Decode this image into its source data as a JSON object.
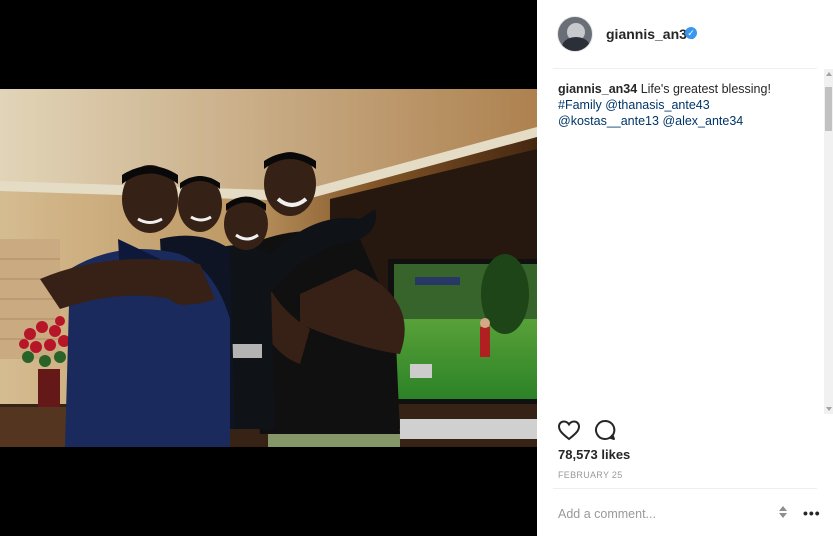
{
  "post": {
    "username": "giannis_an34",
    "verified_icon": "verified-badge-icon",
    "caption": {
      "user": "giannis_an34",
      "text": "Life's greatest blessing!",
      "hashtag": "#Family",
      "mentions": [
        "@thanasis_ante43",
        "@kostas__ante13",
        "@alex_ante34"
      ]
    },
    "likes": "78,573 likes",
    "date": "FEBRUARY 25",
    "comment_placeholder": "Add a comment...",
    "more_label": "•••"
  },
  "icons": {
    "like": "heart-icon",
    "comment": "comment-bubble-icon",
    "more": "more-options-icon"
  },
  "colors": {
    "link": "#003569",
    "verified": "#3897f0",
    "muted": "#999999",
    "text": "#262626"
  }
}
